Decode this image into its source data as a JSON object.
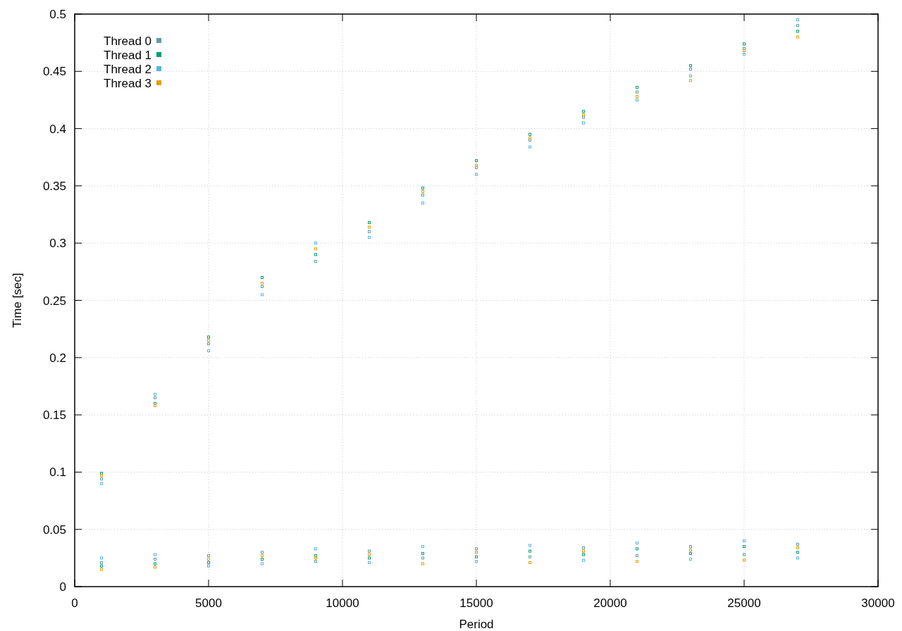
{
  "chart_data": {
    "type": "scatter",
    "xlabel": "Period",
    "ylabel": "Time [sec]",
    "grid": true,
    "legend": "upper left",
    "xlim": [
      0,
      30000
    ],
    "ylim": [
      0,
      0.5
    ],
    "xticks": [
      0,
      5000,
      10000,
      15000,
      20000,
      25000,
      30000
    ],
    "yticks": [
      0,
      0.05,
      0.1,
      0.15,
      0.2,
      0.25,
      0.3,
      0.35,
      0.4,
      0.45,
      0.5
    ],
    "x": [
      1000,
      3000,
      5000,
      7000,
      9000,
      11000,
      13000,
      15000,
      17000,
      19000,
      21000,
      23000,
      25000,
      27000,
      1000,
      3000,
      5000,
      7000,
      9000,
      11000,
      13000,
      15000,
      17000,
      19000,
      21000,
      23000,
      25000,
      27000
    ],
    "series": [
      {
        "name": "Thread 0",
        "color": "#5f9ea0",
        "values": [
          0.094,
          0.165,
          0.212,
          0.262,
          0.284,
          0.31,
          0.342,
          0.366,
          0.39,
          0.41,
          0.432,
          0.452,
          0.47,
          0.49,
          0.021,
          0.024,
          0.027,
          0.03,
          0.022,
          0.031,
          0.025,
          0.033,
          0.026,
          0.034,
          0.027,
          0.035,
          0.028,
          0.037
        ]
      },
      {
        "name": "Thread 1",
        "color": "#009e73",
        "values": [
          0.099,
          0.16,
          0.218,
          0.27,
          0.29,
          0.318,
          0.348,
          0.372,
          0.395,
          0.415,
          0.436,
          0.455,
          0.474,
          0.485,
          0.018,
          0.02,
          0.021,
          0.024,
          0.027,
          0.025,
          0.029,
          0.026,
          0.031,
          0.028,
          0.033,
          0.029,
          0.035,
          0.03
        ]
      },
      {
        "name": "Thread 2",
        "color": "#56b4e9",
        "values": [
          0.09,
          0.168,
          0.206,
          0.255,
          0.3,
          0.305,
          0.335,
          0.36,
          0.384,
          0.405,
          0.425,
          0.446,
          0.465,
          0.495,
          0.025,
          0.028,
          0.018,
          0.02,
          0.033,
          0.021,
          0.035,
          0.022,
          0.036,
          0.023,
          0.038,
          0.024,
          0.04,
          0.025
        ]
      },
      {
        "name": "Thread 3",
        "color": "#e69f00",
        "values": [
          0.097,
          0.158,
          0.215,
          0.265,
          0.295,
          0.314,
          0.345,
          0.368,
          0.392,
          0.412,
          0.428,
          0.442,
          0.468,
          0.48,
          0.015,
          0.017,
          0.024,
          0.027,
          0.025,
          0.028,
          0.02,
          0.03,
          0.021,
          0.031,
          0.022,
          0.032,
          0.023,
          0.034
        ]
      }
    ]
  }
}
